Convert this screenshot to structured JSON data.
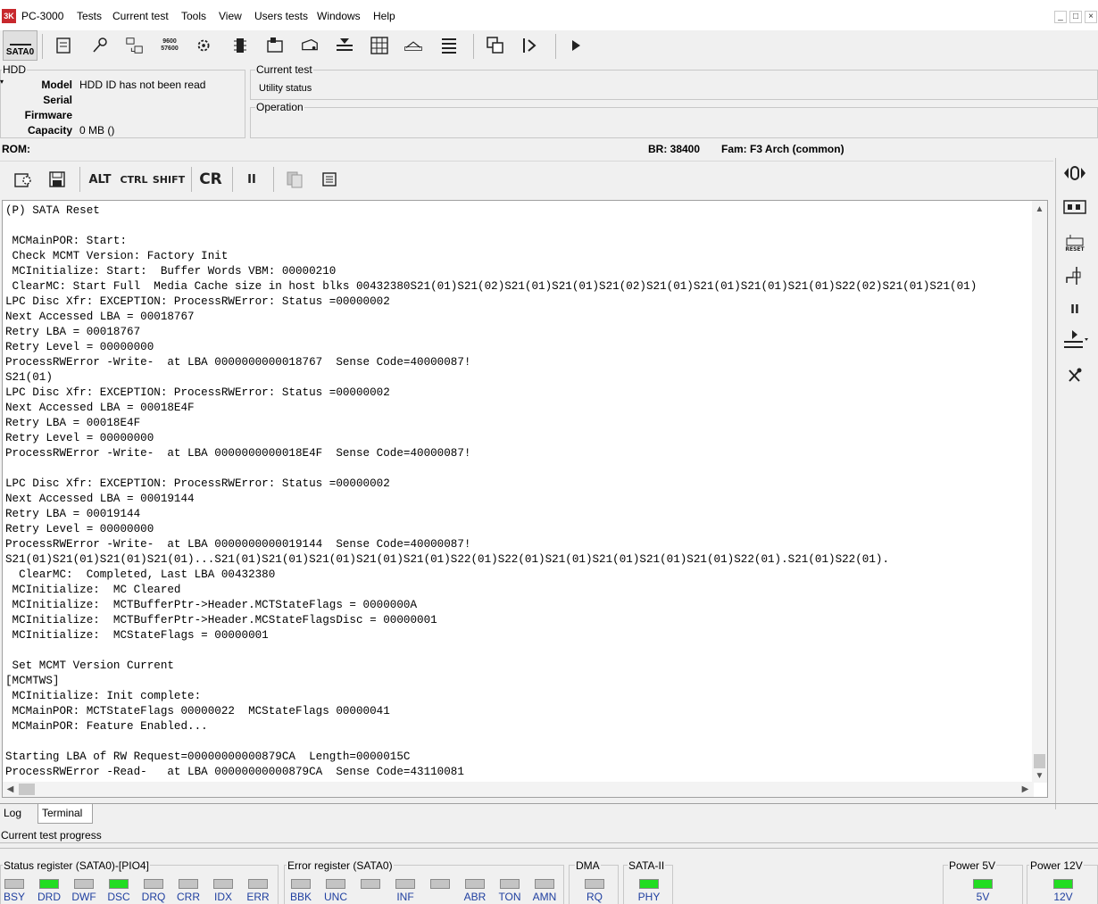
{
  "app": {
    "title": "PC-3000",
    "logo_text": "3K"
  },
  "menu": [
    "Tests",
    "Current test",
    "Tools",
    "View",
    "Users tests",
    "Windows",
    "Help"
  ],
  "window_buttons": [
    "_",
    "□",
    "×"
  ],
  "toolbar": {
    "interface_label": "SATA0",
    "icons": [
      "passport-icon",
      "key-icon",
      "settings-transfer-icon",
      "baud-rate-icon",
      "gear-tools-icon",
      "chip-icon",
      "rom-icon",
      "heads-icon",
      "head-map-icon",
      "grid-table-icon",
      "utilities-icon",
      "list-icon",
      "copy-windows-icon",
      "user-test-icon",
      "play-icon"
    ],
    "baud_icon_text": [
      "9600",
      "57600"
    ]
  },
  "hdd": {
    "title": "HDD",
    "model_label": "Model",
    "model_value": "HDD ID has not been read",
    "serial_label": "Serial",
    "serial_value": "",
    "firmware_label": "Firmware",
    "firmware_value": "",
    "capacity_label": "Capacity",
    "capacity_value": "0 MB ()"
  },
  "current_test": {
    "title": "Current test",
    "status": "Utility status"
  },
  "operation": {
    "title": "Operation"
  },
  "rom_line": {
    "rom_label": "ROM:",
    "br": "BR: 38400",
    "family": "Fam: F3 Arch (common)"
  },
  "terminal_toolbar": {
    "alt": "ALT",
    "ctrl": "CTRL",
    "shift": "SHIFT",
    "cr": "CR",
    "pause": "II"
  },
  "terminal_lines": [
    "(P) SATA Reset",
    "",
    " MCMainPOR: Start:",
    " Check MCMT Version: Factory Init",
    " MCInitialize: Start:  Buffer Words VBM: 00000210",
    " ClearMC: Start Full  Media Cache size in host blks 00432380S21(01)S21(02)S21(01)S21(01)S21(02)S21(01)S21(01)S21(01)S21(01)S22(02)S21(01)S21(01)",
    "LPC Disc Xfr: EXCEPTION: ProcessRWError: Status =00000002",
    "Next Accessed LBA = 00018767",
    "Retry LBA = 00018767",
    "Retry Level = 00000000",
    "ProcessRWError -Write-  at LBA 0000000000018767  Sense Code=40000087!",
    "S21(01)",
    "LPC Disc Xfr: EXCEPTION: ProcessRWError: Status =00000002",
    "Next Accessed LBA = 00018E4F",
    "Retry LBA = 00018E4F",
    "Retry Level = 00000000",
    "ProcessRWError -Write-  at LBA 0000000000018E4F  Sense Code=40000087!",
    "",
    "LPC Disc Xfr: EXCEPTION: ProcessRWError: Status =00000002",
    "Next Accessed LBA = 00019144",
    "Retry LBA = 00019144",
    "Retry Level = 00000000",
    "ProcessRWError -Write-  at LBA 0000000000019144  Sense Code=40000087!",
    "S21(01)S21(01)S21(01)S21(01)...S21(01)S21(01)S21(01)S21(01)S21(01)S22(01)S22(01)S21(01)S21(01)S21(01)S21(01)S22(01).S21(01)S22(01).",
    "  ClearMC:  Completed, Last LBA 00432380",
    " MCInitialize:  MC Cleared",
    " MCInitialize:  MCTBufferPtr->Header.MCTStateFlags = 0000000A",
    " MCInitialize:  MCTBufferPtr->Header.MCStateFlagsDisc = 00000001",
    " MCInitialize:  MCStateFlags = 00000001",
    "",
    " Set MCMT Version Current",
    "[MCMTWS]",
    " MCInitialize: Init complete:",
    " MCMainPOR: MCTStateFlags 00000022  MCStateFlags 00000041",
    " MCMainPOR: Feature Enabled...",
    "",
    "Starting LBA of RW Request=00000000000879CA  Length=0000015C",
    "ProcessRWError -Read-   at LBA 00000000000879CA  Sense Code=43110081"
  ],
  "right_panel": {
    "icons": [
      "power-toggle-icon",
      "adapter-icon",
      "reset-icon",
      "sata-power-icon",
      "pause-icon",
      "play-heads-icon",
      "tools-icon"
    ],
    "reset_text": "RESET",
    "pause_text": "II"
  },
  "tabs": [
    {
      "label": "Log",
      "active": false
    },
    {
      "label": "Terminal",
      "active": true
    }
  ],
  "progress": {
    "label": "Current test progress",
    "value": 0
  },
  "registers": {
    "status": {
      "title": "Status register (SATA0)-[PIO4]",
      "leds": [
        {
          "label": "BSY",
          "on": false
        },
        {
          "label": "DRD",
          "on": true
        },
        {
          "label": "DWF",
          "on": false
        },
        {
          "label": "DSC",
          "on": true
        },
        {
          "label": "DRQ",
          "on": false
        },
        {
          "label": "CRR",
          "on": false
        },
        {
          "label": "IDX",
          "on": false
        },
        {
          "label": "ERR",
          "on": false
        }
      ]
    },
    "error": {
      "title": "Error register (SATA0)",
      "leds": [
        {
          "label": "BBK",
          "on": false
        },
        {
          "label": "UNC",
          "on": false
        },
        {
          "label": "",
          "on": false
        },
        {
          "label": "INF",
          "on": false
        },
        {
          "label": "",
          "on": false
        },
        {
          "label": "ABR",
          "on": false
        },
        {
          "label": "TON",
          "on": false
        },
        {
          "label": "AMN",
          "on": false
        }
      ]
    },
    "dma": {
      "title": "DMA",
      "leds": [
        {
          "label": "RQ",
          "on": false
        }
      ]
    },
    "sata2": {
      "title": "SATA-II",
      "leds": [
        {
          "label": "PHY",
          "on": true
        }
      ]
    },
    "power5": {
      "title": "Power 5V",
      "leds": [
        {
          "label": "5V",
          "on": true
        }
      ]
    },
    "power12": {
      "title": "Power 12V",
      "leds": [
        {
          "label": "12V",
          "on": true
        }
      ]
    }
  },
  "colors": {
    "led_on": "#22dd22",
    "led_off": "#c4c4c4",
    "label_blue": "#2040a0"
  }
}
